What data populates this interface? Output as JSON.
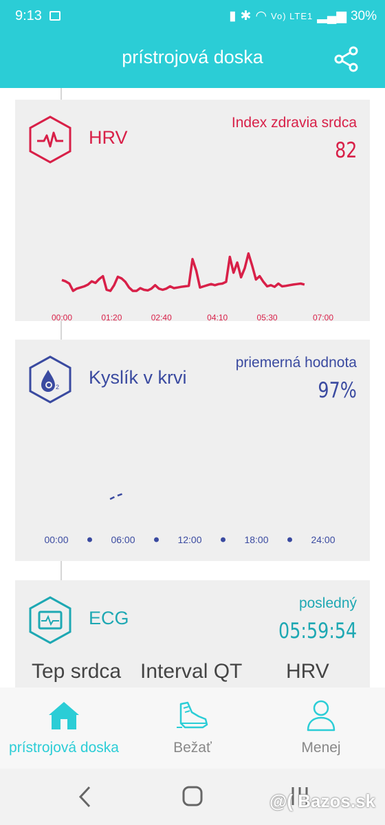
{
  "status": {
    "time": "9:13",
    "signal_label": "Vo) LTE1",
    "battery": "30%"
  },
  "header": {
    "title": "prístrojová doska",
    "share_icon": "share-icon"
  },
  "cards": {
    "hrv": {
      "title": "HRV",
      "right_label": "Index zdravia srdca",
      "right_value": "82",
      "icon": "heartbeat-hexagon-icon",
      "color": "#d82048"
    },
    "spo2": {
      "title": "Kyslík v krvi",
      "right_label": "priemerná hodnota",
      "right_value": "97%",
      "icon": "oxygen-drop-hexagon-icon",
      "color": "#3a4aa0"
    },
    "ecg": {
      "title": "ECG",
      "right_label": "posledný",
      "right_value": "05:59:54",
      "icon": "ecg-monitor-hexagon-icon",
      "color": "#1ea8b3",
      "metrics": [
        "Tep srdca",
        "Interval QT",
        "HRV"
      ]
    }
  },
  "chart_data": [
    {
      "type": "line",
      "x_ticks": [
        "00:00",
        "01:20",
        "02:40",
        "04:10",
        "05:30",
        "07:00"
      ],
      "x_range": [
        "00:00",
        "07:00"
      ],
      "y_axis": "none",
      "x": [
        "00:00",
        "00:06",
        "00:12",
        "00:18",
        "00:24",
        "00:30",
        "00:36",
        "00:42",
        "00:48",
        "00:54",
        "01:00",
        "01:06",
        "01:12",
        "01:18",
        "01:24",
        "01:30",
        "01:36",
        "01:42",
        "01:48",
        "01:54",
        "02:00",
        "02:06",
        "02:12",
        "02:18",
        "02:24",
        "02:30",
        "02:36",
        "02:42",
        "02:48",
        "02:54",
        "03:00",
        "03:06",
        "03:12",
        "03:18",
        "03:24",
        "03:30",
        "03:36",
        "03:42",
        "03:48",
        "03:54",
        "04:00",
        "04:06",
        "04:12",
        "04:18",
        "04:24",
        "04:30",
        "04:36",
        "04:42",
        "04:48",
        "04:54",
        "05:00",
        "05:06",
        "05:12",
        "05:18",
        "05:24",
        "05:30",
        "05:36",
        "05:42",
        "05:48",
        "05:54",
        "06:00",
        "06:06",
        "06:12",
        "06:18",
        "06:24",
        "06:30",
        "06:36",
        "06:42",
        "06:48",
        "06:54",
        "07:00"
      ],
      "values": [
        0.78,
        0.72,
        0.62,
        0.3,
        0.4,
        0.45,
        0.5,
        0.58,
        0.72,
        0.65,
        0.82,
        0.95,
        0.35,
        0.3,
        0.55,
        0.92,
        0.85,
        0.7,
        0.45,
        0.3,
        0.3,
        0.42,
        0.35,
        0.32,
        0.4,
        0.55,
        0.4,
        0.35,
        0.4,
        0.5,
        0.42,
        0.45,
        0.48,
        0.5,
        0.52,
        1.7,
        1.2,
        0.45,
        0.5,
        0.55,
        0.6,
        0.55,
        0.6,
        0.62,
        0.7,
        1.8,
        1.1,
        1.55,
        0.9,
        1.3,
        1.95,
        1.4,
        0.8,
        0.95,
        0.7,
        0.5,
        0.55,
        0.48,
        0.62,
        0.5,
        0.52,
        0.55,
        0.58,
        0.6,
        0.62,
        0.58,
        0.6,
        0.62,
        0.6,
        0.62,
        0.6
      ],
      "note_color": "#d82048"
    },
    {
      "type": "line",
      "x_ticks": [
        "00:00",
        "06:00",
        "12:00",
        "18:00",
        "24:00"
      ],
      "x_range": [
        "00:00",
        "24:00"
      ],
      "y_axis": "none",
      "x": [
        "04:50",
        "05:20",
        "06:10"
      ],
      "values": [
        96.6,
        97.0,
        97.5
      ],
      "line_style": "dashed",
      "note_color": "#3a4aa0"
    }
  ],
  "bottom_nav": [
    {
      "label": "prístrojová doska",
      "icon": "home-icon",
      "active": true
    },
    {
      "label": "Bežať",
      "icon": "running-shoe-icon",
      "active": false
    },
    {
      "label": "Menej",
      "icon": "person-icon",
      "active": false
    }
  ],
  "watermark": "@( Bazos.sk"
}
